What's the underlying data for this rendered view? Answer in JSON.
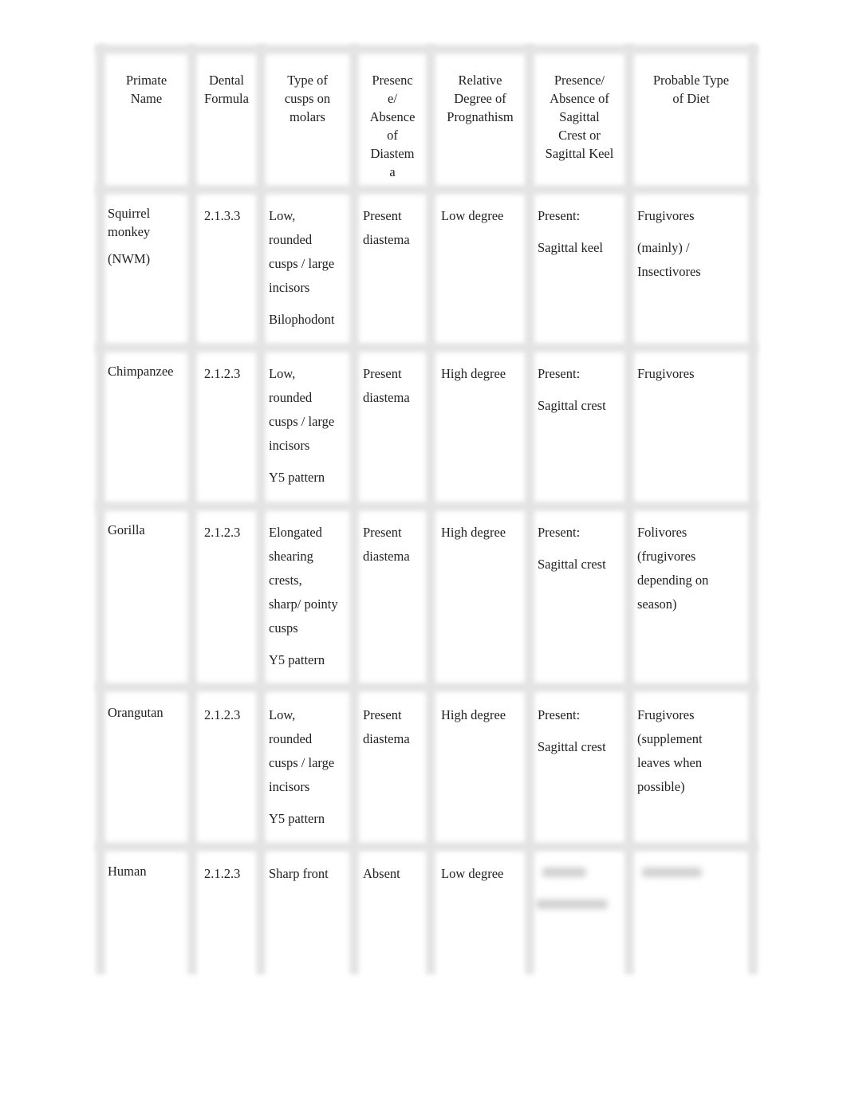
{
  "table": {
    "headers": [
      [
        "Primate",
        "Name"
      ],
      [
        "Dental",
        "Formula"
      ],
      [
        "Type of",
        "cusps on",
        "molars"
      ],
      [
        "Presenc",
        "e/",
        "Absence",
        "of",
        "Diastem",
        "a"
      ],
      [
        "Relative",
        "Degree of",
        "Prognathism"
      ],
      [
        "Presence/",
        "Absence of",
        "Sagittal",
        "Crest or",
        "Sagittal Keel"
      ],
      [
        "Probable Type",
        "of Diet"
      ]
    ],
    "rows": [
      [
        [
          [
            "Squirrel",
            "monkey"
          ],
          [
            "(NWM)"
          ]
        ],
        [
          [
            "2.1.3.3"
          ]
        ],
        [
          [
            "Low,",
            "rounded",
            "cusps / large",
            "incisors"
          ],
          [
            "Bilophodont"
          ]
        ],
        [
          [
            "Present",
            "diastema"
          ]
        ],
        [
          [
            "Low degree"
          ]
        ],
        [
          [
            "Present:"
          ],
          [
            "Sagittal keel"
          ]
        ],
        [
          [
            "Frugivores"
          ],
          [
            "(mainly) /",
            "Insectivores"
          ]
        ]
      ],
      [
        [
          [
            "Chimpanzee"
          ]
        ],
        [
          [
            "2.1.2.3"
          ]
        ],
        [
          [
            "Low,",
            "rounded",
            "cusps / large",
            "incisors"
          ],
          [
            "Y5 pattern"
          ]
        ],
        [
          [
            "Present",
            "diastema"
          ]
        ],
        [
          [
            "High degree"
          ]
        ],
        [
          [
            "Present:"
          ],
          [
            "Sagittal crest"
          ]
        ],
        [
          [
            "Frugivores"
          ]
        ]
      ],
      [
        [
          [
            "Gorilla"
          ]
        ],
        [
          [
            "2.1.2.3"
          ]
        ],
        [
          [
            "Elongated",
            "shearing",
            "crests,",
            "sharp/ pointy",
            "cusps"
          ],
          [
            "Y5 pattern"
          ]
        ],
        [
          [
            "Present",
            "diastema"
          ]
        ],
        [
          [
            "High degree"
          ]
        ],
        [
          [
            "Present:"
          ],
          [
            "Sagittal crest"
          ]
        ],
        [
          [
            "Folivores",
            "(frugivores",
            "depending on",
            "season)"
          ]
        ]
      ],
      [
        [
          [
            "Orangutan"
          ]
        ],
        [
          [
            "2.1.2.3"
          ]
        ],
        [
          [
            "Low,",
            "rounded",
            "cusps / large",
            "incisors"
          ],
          [
            "Y5 pattern"
          ]
        ],
        [
          [
            "Present",
            "diastema"
          ]
        ],
        [
          [
            "High degree"
          ]
        ],
        [
          [
            "Present:"
          ],
          [
            "Sagittal crest"
          ]
        ],
        [
          [
            "Frugivores",
            "(supplement",
            "leaves when",
            "possible)"
          ]
        ]
      ],
      [
        [
          [
            "Human"
          ]
        ],
        [
          [
            "2.1.2.3"
          ]
        ],
        [
          [
            "Sharp front"
          ]
        ],
        [
          [
            "Absent"
          ]
        ],
        [
          [
            "Low degree"
          ]
        ],
        [],
        []
      ]
    ]
  }
}
